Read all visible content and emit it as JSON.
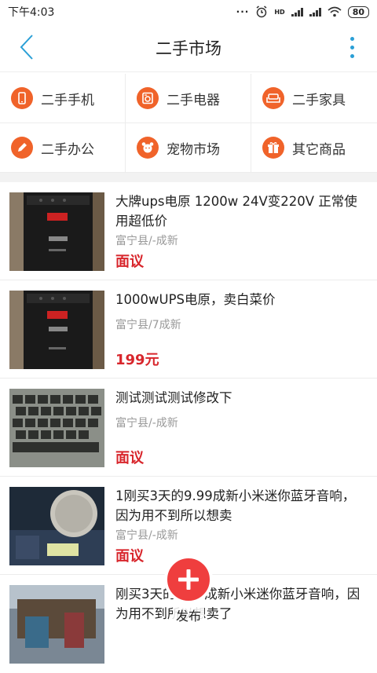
{
  "status_bar": {
    "time": "下午4:03",
    "battery": "80",
    "dots": "···",
    "hd": "HD"
  },
  "header": {
    "title": "二手市场"
  },
  "categories": [
    {
      "label": "二手手机",
      "icon": "phone-icon"
    },
    {
      "label": "二手电器",
      "icon": "appliance-icon"
    },
    {
      "label": "二手家具",
      "icon": "sofa-icon"
    },
    {
      "label": "二手办公",
      "icon": "pen-icon"
    },
    {
      "label": "宠物市场",
      "icon": "pet-icon"
    },
    {
      "label": "其它商品",
      "icon": "gift-icon"
    }
  ],
  "listings": [
    {
      "title": "大牌ups电原 1200w 24V变220V 正常使用超低价",
      "meta": "富宁县/-成新",
      "price": "面议",
      "image": "ups-photo"
    },
    {
      "title": "1000wUPS电原，卖白菜价",
      "meta": "富宁县/7成新",
      "price": "199元",
      "image": "ups-photo"
    },
    {
      "title": "测试测试测试修改下",
      "meta": "富宁县/-成新",
      "price": "面议",
      "image": "keyboard-photo"
    },
    {
      "title": "1刚买3天的9.99成新小米迷你蓝牙音响，因为用不到所以想卖",
      "meta": "富宁县/-成新",
      "price": "面议",
      "image": "speaker-photo"
    },
    {
      "title": "刚买3天的9.99成新小米迷你蓝牙音响，因为用不到所以想卖了",
      "meta": "",
      "price": "",
      "image": "market-photo"
    }
  ],
  "fab": {
    "label": "发布"
  },
  "colors": {
    "accent_blue": "#2a9fd6",
    "category_orange": "#f0632a",
    "price_red": "#d8262c",
    "fab_red": "#ef3e3e"
  }
}
